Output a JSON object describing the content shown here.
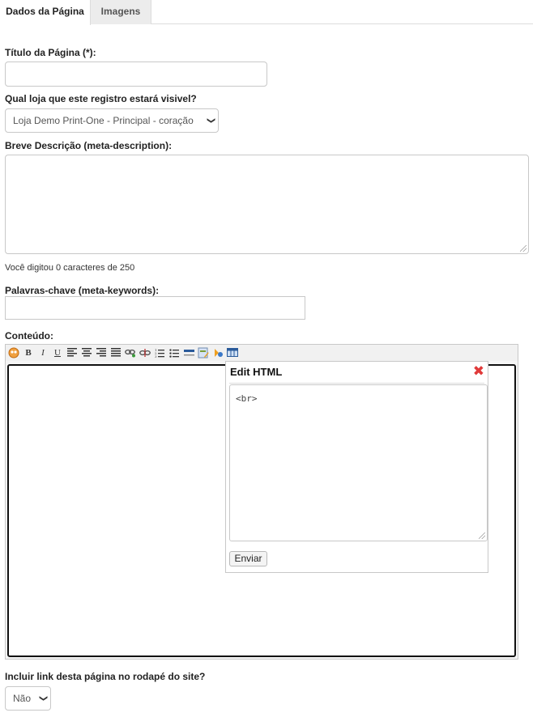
{
  "tabs": [
    {
      "label": "Dados da Página",
      "active": true
    },
    {
      "label": "Imagens",
      "active": false
    }
  ],
  "form": {
    "titulo_label": "Título da Página (*):",
    "titulo_value": "",
    "loja_label": "Qual loja que este registro estará visivel?",
    "loja_selected": "Loja Demo Print-One - Principal - coração",
    "descricao_label": "Breve Descrição (meta-description):",
    "descricao_value": "",
    "char_counter": "Você digitou 0 caracteres de 250",
    "keywords_label": "Palavras-chave (meta-keywords):",
    "keywords_value": "",
    "conteudo_label": "Conteúdo:",
    "rodape_label": "Incluir link desta página no rodapé do site?",
    "rodape_selected": "Não"
  },
  "toolbar_icons": [
    "html-source-icon",
    "bold-icon",
    "italic-icon",
    "underline-icon",
    "align-left-icon",
    "align-center-icon",
    "align-right-icon",
    "align-justify-icon",
    "link-icon",
    "unlink-icon",
    "ordered-list-icon",
    "unordered-list-icon",
    "horizontal-rule-icon",
    "image-icon",
    "insert-special-icon",
    "table-icon"
  ],
  "toolbar_glyphs": {
    "bold": "B",
    "italic": "I",
    "underline": "U"
  },
  "popup": {
    "title": "Edit HTML",
    "close_glyph": "✖",
    "content": "<br>",
    "submit_label": "Enviar"
  },
  "colors": {
    "close_red": "#e03a3a",
    "border": "#c8c8c8",
    "editor_border": "#111111"
  }
}
